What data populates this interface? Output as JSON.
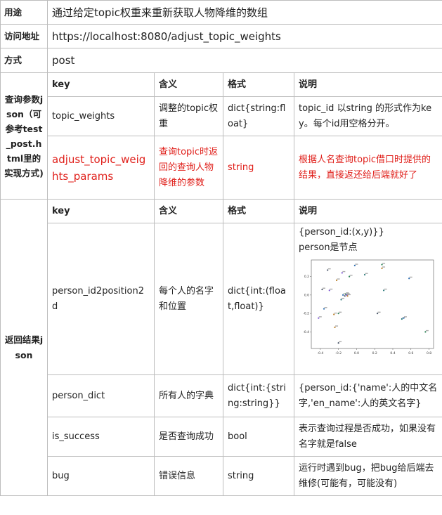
{
  "rows": {
    "purpose": {
      "label": "用途",
      "value": "通过给定topic权重来重新获取人物降维的数组"
    },
    "url": {
      "label": "访问地址",
      "value": "https://localhost:8080/adjust_topic_weights"
    },
    "method": {
      "label": "方式",
      "value": "post"
    }
  },
  "query": {
    "label": "查询参数json（可参考test_post.html里的实现方式)",
    "headers": {
      "key": "key",
      "meaning": "含义",
      "format": "格式",
      "desc": "说明"
    },
    "items": [
      {
        "key": "topic_weights",
        "meaning": "调整的topic权重",
        "format": "dict{string:float}",
        "desc": "topic_id 以string 的形式作为key。每个id用空格分开。"
      },
      {
        "key": "adjust_topic_weights_params",
        "meaning": "查询topic时返回的查询人物降维的参数",
        "format": "string",
        "desc": "根据人名查询topic借口时提供的结果，直接返还给后端就好了"
      }
    ]
  },
  "response": {
    "label": "返回结果json",
    "headers": {
      "key": "key",
      "meaning": "含义",
      "format": "格式",
      "desc": "说明"
    },
    "items": [
      {
        "key": "person_id2position2d",
        "meaning": "每个人的名字和位置",
        "format": "dict{int:(float,float)}",
        "desc_lines": [
          "{person_id:(x,y)}}",
          "person是节点"
        ]
      },
      {
        "key": "person_dict",
        "meaning": "所有人的字典",
        "format": "dict{int:{string:string}}",
        "desc": "{person_id:{'name':人的中文名字,'en_name':人的英文名字}"
      },
      {
        "key": "is_success",
        "meaning": "是否查询成功",
        "format": "bool",
        "desc": "表示查询过程是否成功，如果没有名字就是false"
      },
      {
        "key": "bug",
        "meaning": "错误信息",
        "format": "string",
        "desc": "运行时遇到bug，把bug给后端去维修(可能有，可能没有)"
      }
    ]
  },
  "chart_data": {
    "type": "scatter",
    "title": "",
    "xlabel": "",
    "ylabel": "",
    "x_ticks": [
      "-0.4",
      "-0.2",
      "0.0",
      "0.2",
      "0.4",
      "0.6",
      "0.8"
    ],
    "y_ticks": [
      "0.2",
      "0.0",
      "-0.2",
      "-0.4"
    ],
    "xlim": [
      -0.5,
      0.85
    ],
    "ylim": [
      -0.58,
      0.38
    ],
    "grid": false,
    "points": [
      {
        "x": -0.02,
        "y": 0.32
      },
      {
        "x": 0.28,
        "y": 0.33
      },
      {
        "x": 0.28,
        "y": 0.29
      },
      {
        "x": -0.32,
        "y": 0.27
      },
      {
        "x": -0.16,
        "y": 0.24
      },
      {
        "x": 0.09,
        "y": 0.22
      },
      {
        "x": 0.58,
        "y": 0.18
      },
      {
        "x": -0.08,
        "y": 0.2
      },
      {
        "x": -0.22,
        "y": 0.16
      },
      {
        "x": -0.38,
        "y": 0.06
      },
      {
        "x": -0.3,
        "y": 0.05
      },
      {
        "x": 0.3,
        "y": 0.05
      },
      {
        "x": -0.15,
        "y": 0.0
      },
      {
        "x": -0.12,
        "y": 0.01
      },
      {
        "x": -0.1,
        "y": -0.01
      },
      {
        "x": -0.13,
        "y": -0.01
      },
      {
        "x": -0.11,
        "y": 0.0
      },
      {
        "x": -0.17,
        "y": -0.05
      },
      {
        "x": -0.36,
        "y": -0.15
      },
      {
        "x": -0.2,
        "y": -0.2
      },
      {
        "x": -0.25,
        "y": -0.21
      },
      {
        "x": 0.23,
        "y": -0.2
      },
      {
        "x": -0.42,
        "y": -0.25
      },
      {
        "x": 0.5,
        "y": -0.26
      },
      {
        "x": 0.52,
        "y": -0.25
      },
      {
        "x": 0.76,
        "y": -0.4
      },
      {
        "x": -0.24,
        "y": -0.35
      },
      {
        "x": -0.2,
        "y": -0.52
      }
    ]
  }
}
